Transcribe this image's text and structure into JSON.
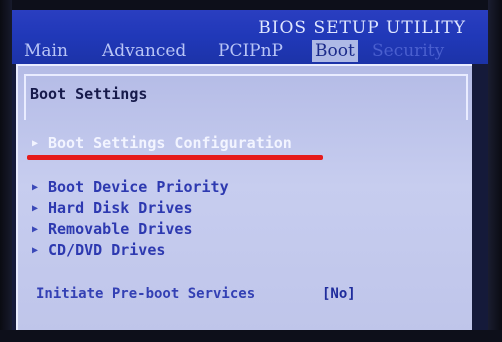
{
  "header": {
    "title": "BIOS SETUP UTILITY",
    "tabs": [
      {
        "label": "Main"
      },
      {
        "label": "Advanced"
      },
      {
        "label": "PCIPnP"
      },
      {
        "label": "Boot"
      },
      {
        "label": "Security"
      }
    ],
    "active_tab": "Boot"
  },
  "panel": {
    "section_title": "Boot Settings",
    "items": [
      {
        "label": "Boot Settings Configuration"
      },
      {
        "label": "Boot Device Priority"
      },
      {
        "label": "Hard Disk Drives"
      },
      {
        "label": "Removable Drives"
      },
      {
        "label": "CD/DVD Drives"
      }
    ],
    "selected_item": "Boot Settings Configuration",
    "option": {
      "label": "Initiate Pre-boot Services",
      "value": "[No]"
    }
  },
  "colors": {
    "header_blue": "#2038b8",
    "panel_lavender": "#c7cdef",
    "highlight_red": "#e61b1b",
    "item_blue": "#2d39b0"
  },
  "icons": {
    "menu_arrow": "triangle-right-icon"
  }
}
